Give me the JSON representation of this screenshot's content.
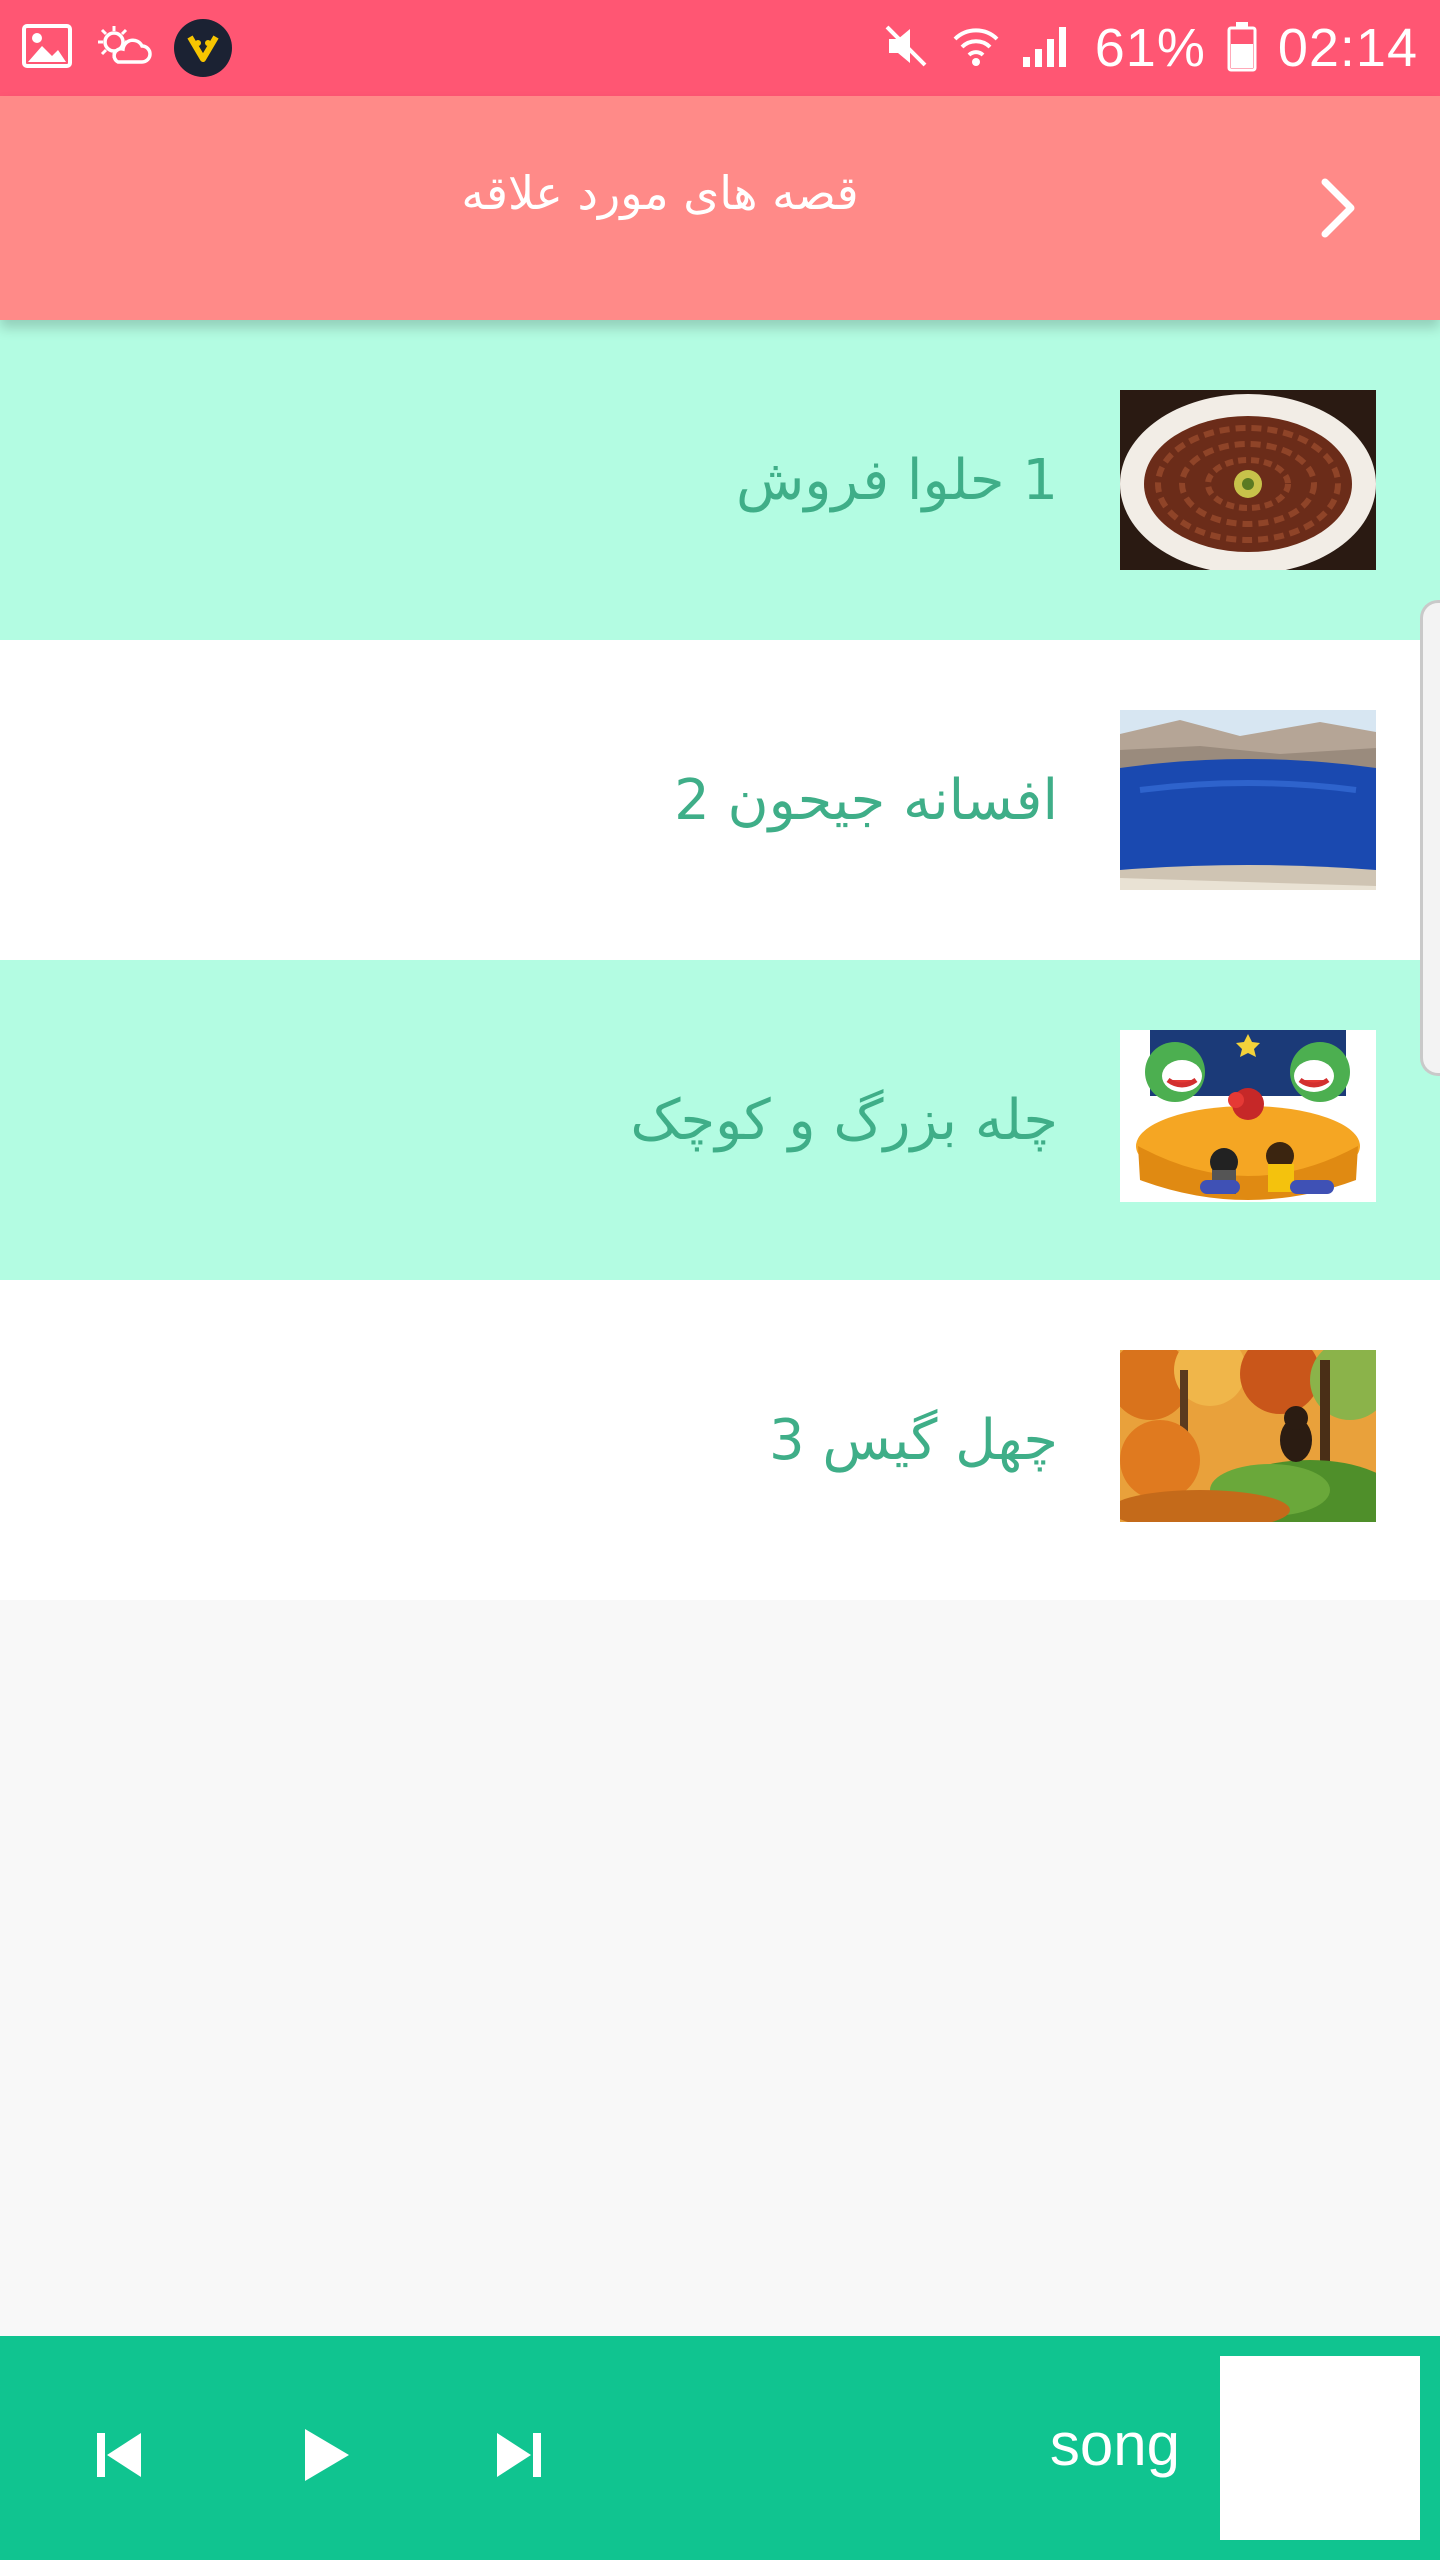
{
  "status_bar": {
    "battery_percent": "61%",
    "time": "02:14",
    "left_icons": [
      "gallery-icon",
      "weather-icon",
      "app-badge-icon"
    ],
    "right_icons": [
      "mute-icon",
      "wifi-icon",
      "signal-icon",
      "battery-icon"
    ]
  },
  "app_bar": {
    "title": "قصه های مورد علاقه",
    "back_icon": "chevron-right-icon"
  },
  "stories": [
    {
      "title": "1 حلوا فروش",
      "thumb": "halva-dessert-image"
    },
    {
      "title": "افسانه جیحون 2",
      "thumb": "blue-lake-image"
    },
    {
      "title": "چله بزرگ و کوچک",
      "thumb": "yalda-night-cartoon-image"
    },
    {
      "title": "چهل گیس 3",
      "thumb": "autumn-forest-bear-image"
    }
  ],
  "player": {
    "song_label": "song",
    "controls": [
      "skip-previous-icon",
      "play-icon",
      "skip-next-icon"
    ]
  },
  "colors": {
    "status_bar": "#ff5673",
    "app_bar": "#ff8a88",
    "row_mint": "#b3fce2",
    "row_white": "#ffffff",
    "title_text": "#3fae88",
    "player_bg": "#10c490"
  }
}
